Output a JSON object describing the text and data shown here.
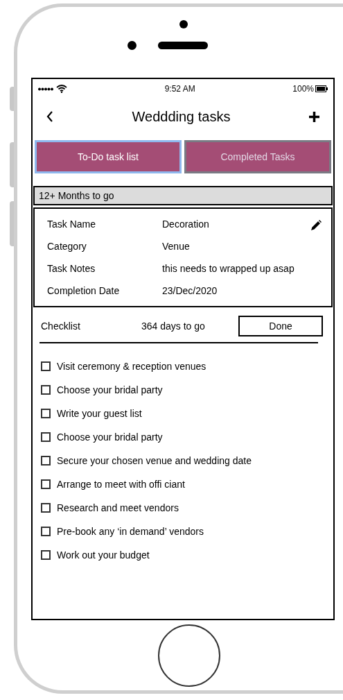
{
  "status_bar": {
    "time": "9:52 AM",
    "battery": "100%"
  },
  "header": {
    "title": "Weddding tasks"
  },
  "tabs": [
    {
      "label": "To-Do task list",
      "selected": true
    },
    {
      "label": "Completed Tasks",
      "selected": false
    }
  ],
  "section": {
    "title": "12+ Months to go"
  },
  "details": [
    {
      "label": "Task Name",
      "value": "Decoration"
    },
    {
      "label": "Category",
      "value": "Venue"
    },
    {
      "label": "Task Notes",
      "value": "this needs to wrapped up asap"
    },
    {
      "label": "Completion Date",
      "value": "23/Dec/2020"
    }
  ],
  "checklist": {
    "title": "Checklist",
    "countdown": "364 days to go",
    "button": "Done"
  },
  "items": [
    {
      "label": "Visit ceremony & reception venues",
      "checked": false
    },
    {
      "label": "Choose your bridal party",
      "checked": false
    },
    {
      "label": "Write your guest list",
      "checked": false
    },
    {
      "label": "Choose your bridal party",
      "checked": false
    },
    {
      "label": "Secure your chosen venue and wedding date",
      "checked": false
    },
    {
      "label": "Arrange to meet with offi ciant",
      "checked": false
    },
    {
      "label": "Research and meet vendors",
      "checked": false
    },
    {
      "label": "Pre-book any ‘in demand’ vendors",
      "checked": false
    },
    {
      "label": "Work out your budget",
      "checked": false
    }
  ]
}
